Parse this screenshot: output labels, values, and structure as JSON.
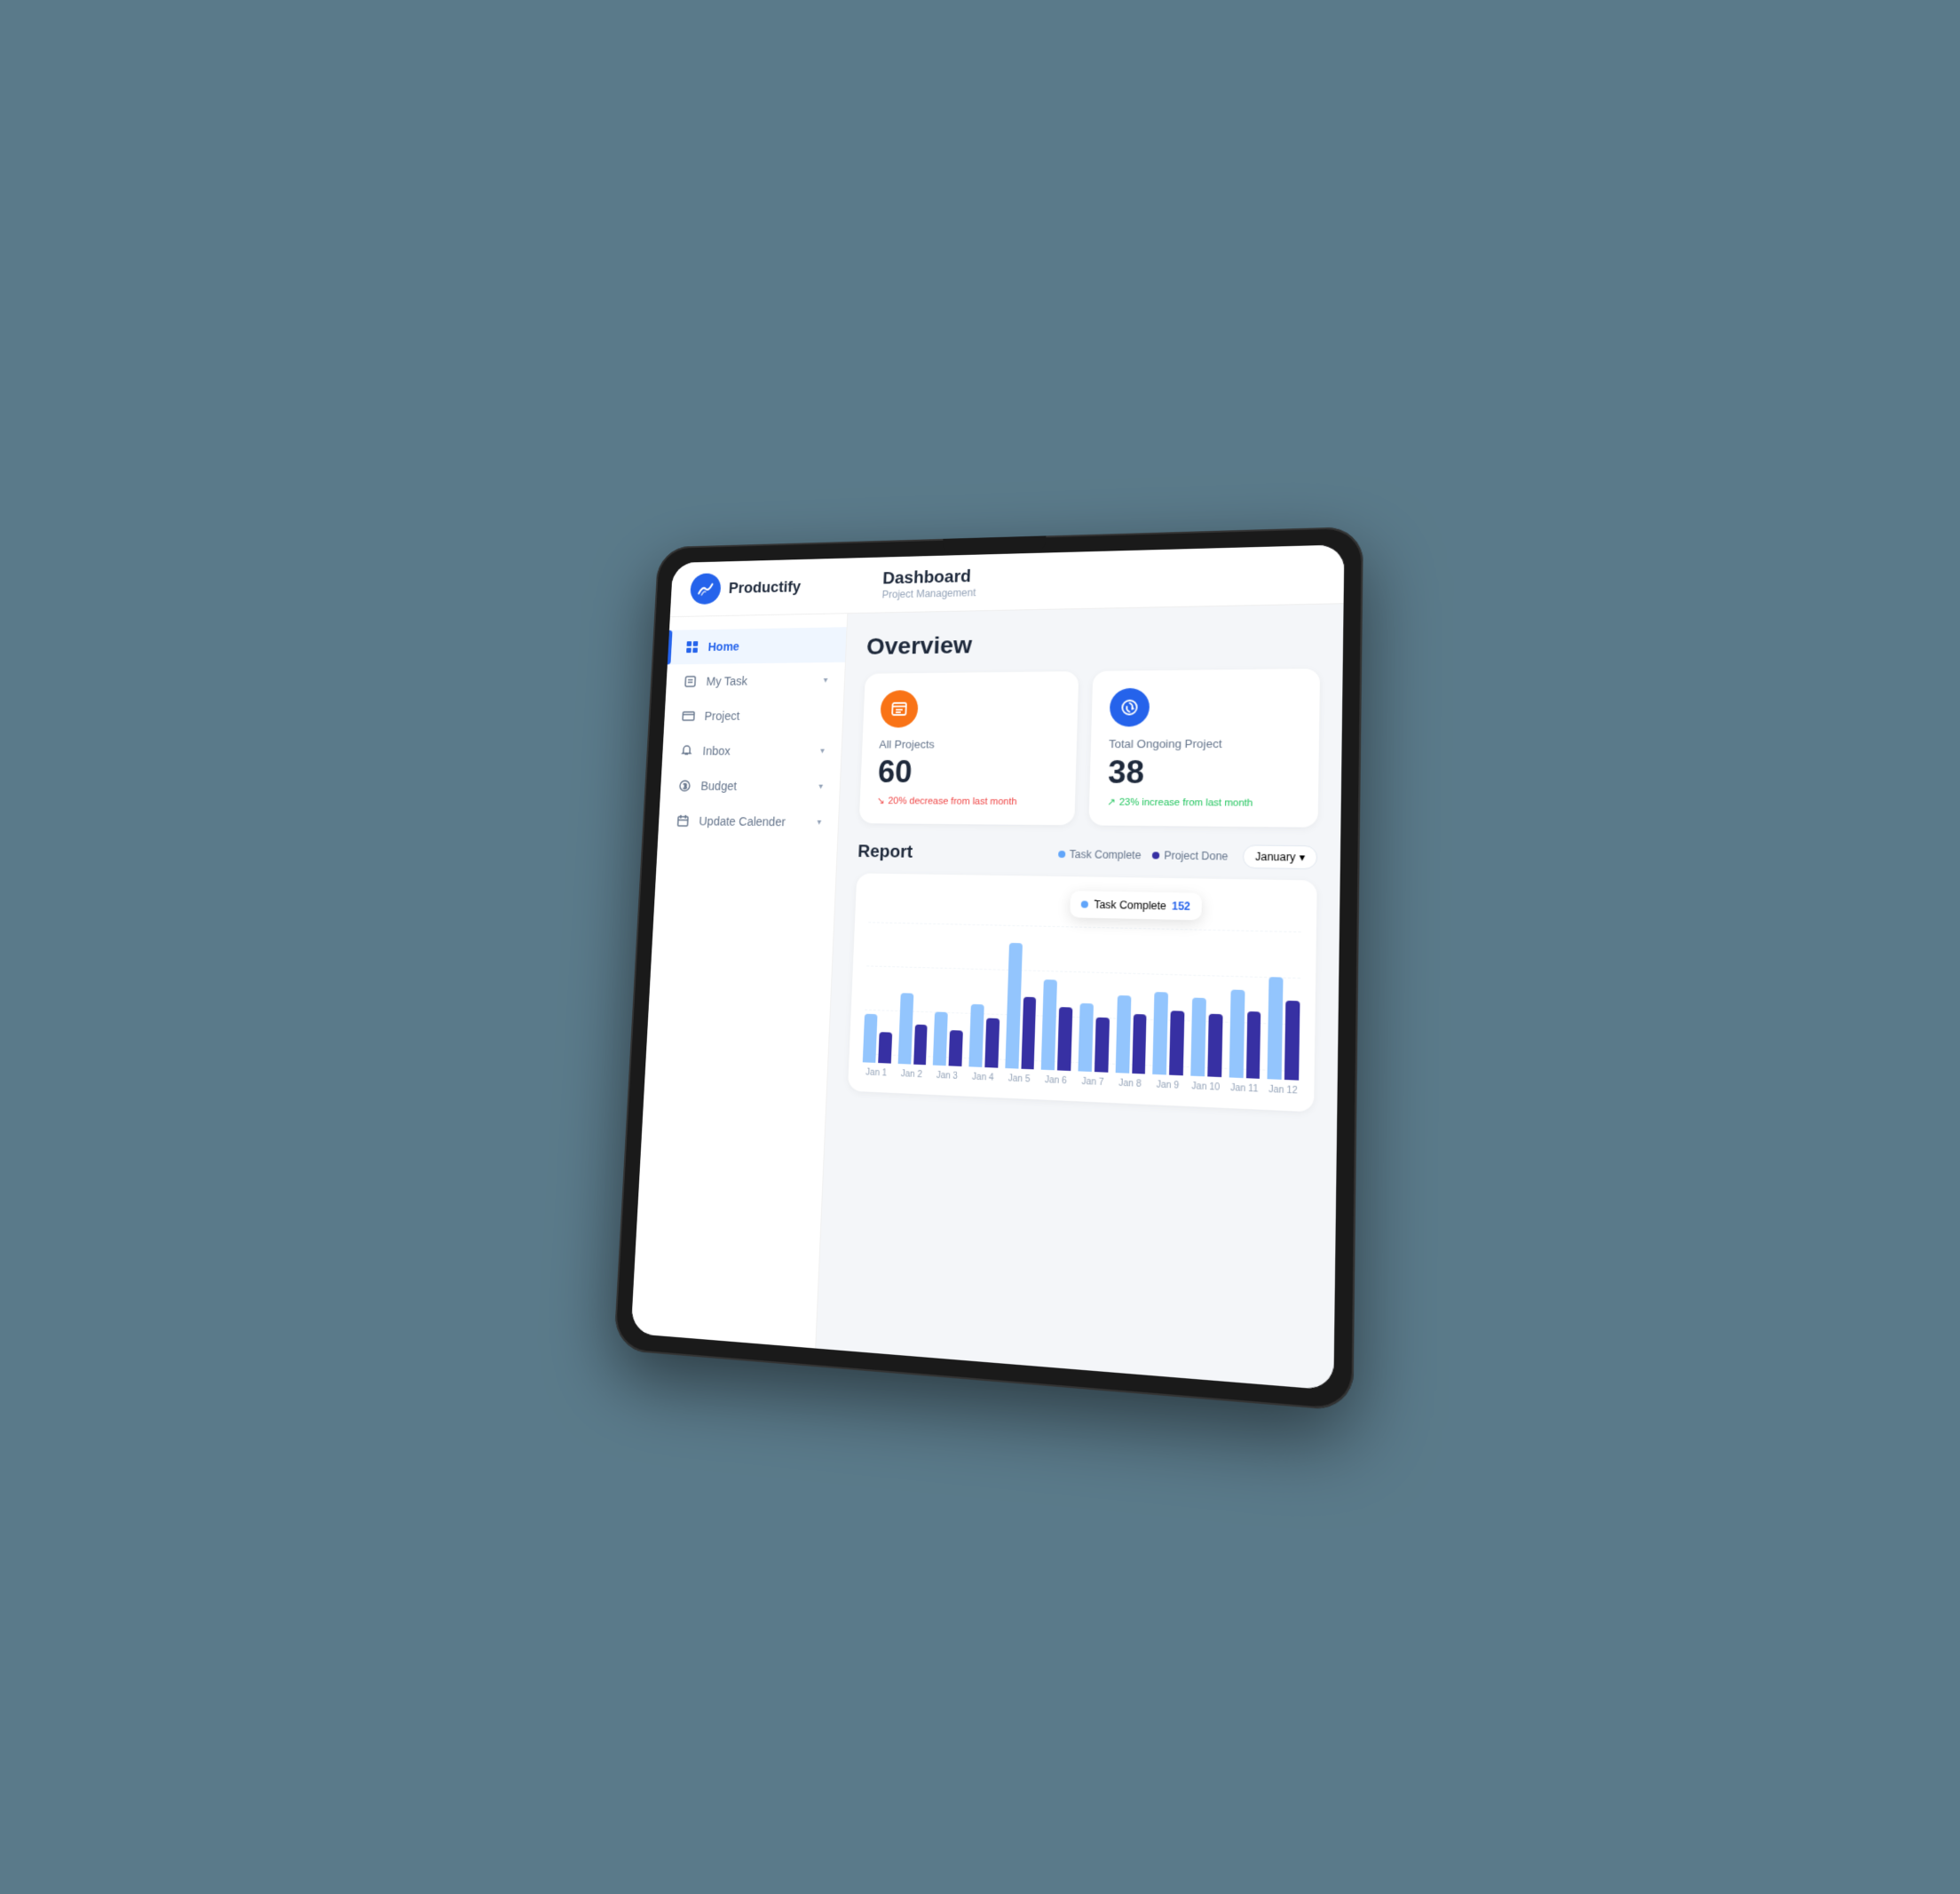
{
  "app": {
    "logo_text": "Productify",
    "header_title": "Dashboard",
    "header_subtitle": "Project Management"
  },
  "sidebar": {
    "items": [
      {
        "id": "home",
        "label": "Home",
        "icon": "grid-icon",
        "active": true,
        "has_chevron": false
      },
      {
        "id": "my-task",
        "label": "My Task",
        "icon": "task-icon",
        "active": false,
        "has_chevron": true
      },
      {
        "id": "project",
        "label": "Project",
        "icon": "project-icon",
        "active": false,
        "has_chevron": false
      },
      {
        "id": "inbox",
        "label": "Inbox",
        "icon": "bell-icon",
        "active": false,
        "has_chevron": true
      },
      {
        "id": "budget",
        "label": "Budget",
        "icon": "budget-icon",
        "active": false,
        "has_chevron": true
      },
      {
        "id": "update-calender",
        "label": "Update Calender",
        "icon": "calendar-icon",
        "active": false,
        "has_chevron": true
      }
    ]
  },
  "overview": {
    "title": "Overview",
    "cards": [
      {
        "id": "all-projects",
        "label": "All Projects",
        "value": "60",
        "change": "20% decrease from last month",
        "change_type": "negative",
        "icon": "projects-icon",
        "icon_color": "orange"
      },
      {
        "id": "total-ongoing",
        "label": "Total Ongoing Project",
        "value": "38",
        "change": "23% increase from last month",
        "change_type": "positive",
        "icon": "refresh-icon",
        "icon_color": "blue"
      }
    ]
  },
  "report": {
    "title": "Report",
    "legend": [
      {
        "label": "Task Complete",
        "color": "#60a5fa"
      },
      {
        "label": "Project Done",
        "color": "#3730a3"
      }
    ],
    "month_selector": "January",
    "tooltip": {
      "label": "Task Complete",
      "value": "152"
    },
    "chart_labels": [
      "Jan 1",
      "Jan 2",
      "Jan 3",
      "Jan 4",
      "Jan 5",
      "Jan 6",
      "Jan 7",
      "Jan 8",
      "Jan 9",
      "Jan 10",
      "Jan 11",
      "Jan 12"
    ],
    "bars": [
      {
        "light": 55,
        "dark": 35
      },
      {
        "light": 80,
        "dark": 45
      },
      {
        "light": 60,
        "dark": 40
      },
      {
        "light": 70,
        "dark": 55
      },
      {
        "light": 140,
        "dark": 80
      },
      {
        "light": 100,
        "dark": 70
      },
      {
        "light": 75,
        "dark": 60
      },
      {
        "light": 85,
        "dark": 65
      },
      {
        "light": 90,
        "dark": 70
      },
      {
        "light": 85,
        "dark": 68
      },
      {
        "light": 95,
        "dark": 72
      },
      {
        "light": 110,
        "dark": 85
      }
    ]
  }
}
